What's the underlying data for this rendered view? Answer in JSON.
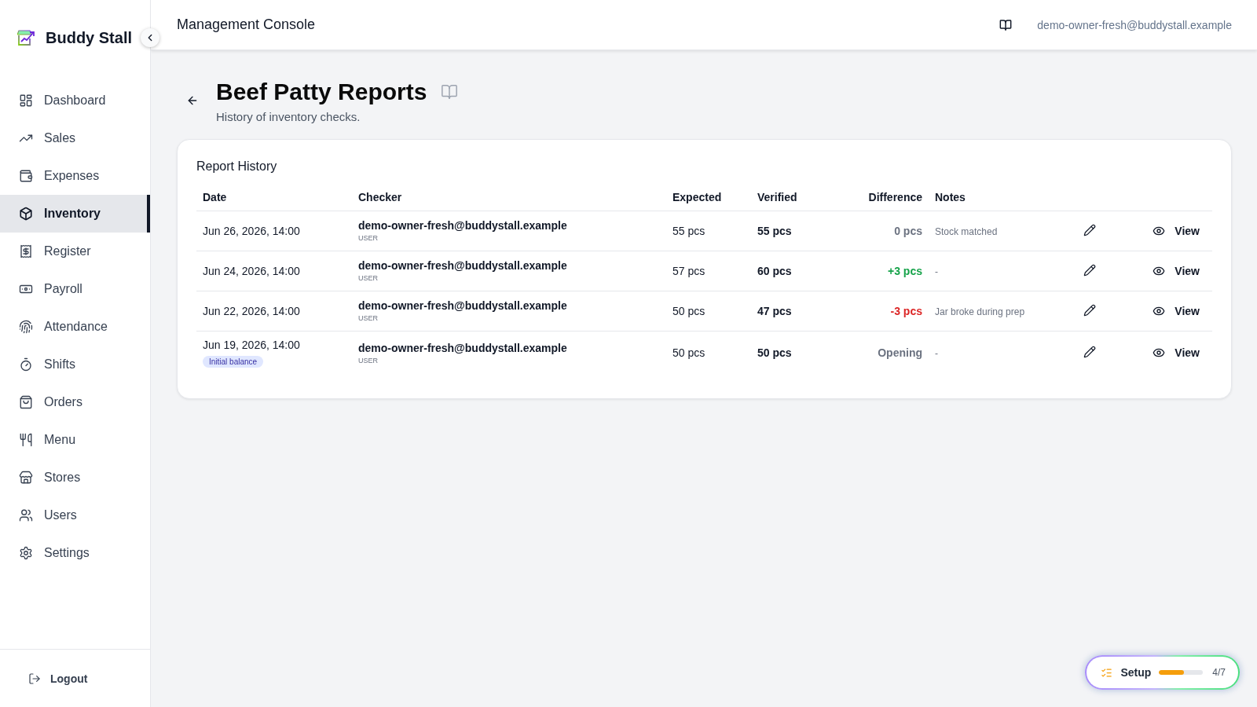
{
  "sidebar": {
    "brand": "Buddy Stall",
    "items": [
      {
        "label": "Dashboard",
        "selected": false
      },
      {
        "label": "Sales",
        "selected": false
      },
      {
        "label": "Expenses",
        "selected": false
      },
      {
        "label": "Inventory",
        "selected": true
      },
      {
        "label": "Register",
        "selected": false
      },
      {
        "label": "Payroll",
        "selected": false
      },
      {
        "label": "Attendance",
        "selected": false
      },
      {
        "label": "Shifts",
        "selected": false
      },
      {
        "label": "Orders",
        "selected": false
      },
      {
        "label": "Menu",
        "selected": false
      },
      {
        "label": "Stores",
        "selected": false
      },
      {
        "label": "Users",
        "selected": false
      },
      {
        "label": "Settings",
        "selected": false
      }
    ],
    "logout": "Logout"
  },
  "header": {
    "title": "Management Console",
    "user_email": "demo-owner-fresh@buddystall.example"
  },
  "page": {
    "title": "Beef Patty Reports",
    "subtitle": "History of inventory checks."
  },
  "report": {
    "title": "Report History",
    "columns": [
      "Date",
      "Checker",
      "Expected",
      "Verified",
      "Difference",
      "Notes"
    ],
    "rows": [
      {
        "date": "Jun 26, 2026, 14:00",
        "checker": "demo-owner-fresh@buddystall.example",
        "role": "USER",
        "expected": "55 pcs",
        "verified": "55 pcs",
        "difference": "0 pcs",
        "color": "#6b7280",
        "notes": "Stock matched",
        "action": "View"
      },
      {
        "date": "Jun 24, 2026, 14:00",
        "checker": "demo-owner-fresh@buddystall.example",
        "role": "USER",
        "expected": "57 pcs",
        "verified": "60 pcs",
        "difference": "+3 pcs",
        "color": "#16a34a",
        "notes": "-",
        "action": "View"
      },
      {
        "date": "Jun 22, 2026, 14:00",
        "checker": "demo-owner-fresh@buddystall.example",
        "role": "USER",
        "expected": "50 pcs",
        "verified": "47 pcs",
        "difference": "-3 pcs",
        "color": "#dc2626",
        "notes": "Jar broke during prep",
        "action": "View"
      },
      {
        "date": "Jun 19, 2026, 14:00",
        "badge": "Initial balance",
        "checker": "demo-owner-fresh@buddystall.example",
        "role": "USER",
        "expected": "50 pcs",
        "verified": "50 pcs",
        "difference": "Opening",
        "color": "#6b7280",
        "notes": "-",
        "action": "View"
      }
    ]
  },
  "setup": {
    "label": "Setup",
    "level": 0.57,
    "progress": "4/7"
  }
}
